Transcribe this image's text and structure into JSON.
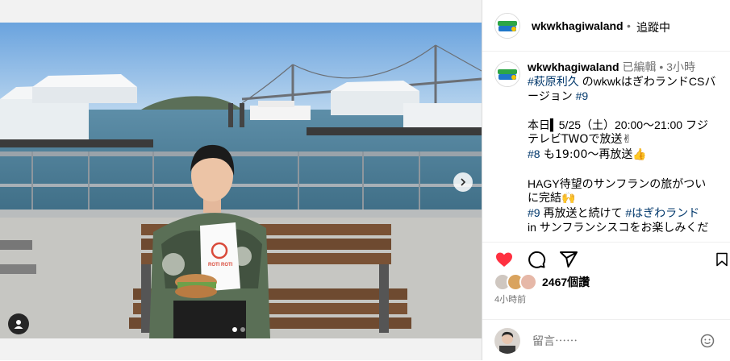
{
  "post": {
    "username": "wkwkhagiwaland",
    "header_separator": "•",
    "follow_status": "追蹤中",
    "caption": {
      "username": "wkwkhagiwaland",
      "edited": "已編輯",
      "separator": "•",
      "time": "3小時",
      "lines": [
        {
          "tag": "#萩原利久",
          "text": " のwkwkはぎわランドCSバ"
        },
        {
          "text": "ージョン "
        },
        {
          "text": ""
        },
        {
          "text": "本日▍5/25（土）20:00～21:00 フジ"
        },
        {
          "text": "テレビTWOで放送✌"
        },
        {
          "tag": "#8",
          "text": " も19:00～再放送👍"
        },
        {
          "text": ""
        },
        {
          "text": "HAGY待望のサンフランの旅がつい"
        },
        {
          "text": "に完結🙌"
        },
        {
          "tag": "#9",
          "text": " 再放送と続けて "
        },
        {
          "text": "in サンフランシスコをお楽しみくだ"
        }
      ],
      "line2_tag": "#9",
      "line10_tag2": "#はぎわランド"
    },
    "likes_count": "2467個讚",
    "time_ago": "4小時前",
    "comment_placeholder": "留言⋯⋯",
    "photo_sign_text": "ROTI ROTI"
  },
  "icons": {
    "like": "heart-filled-icon",
    "comment": "comment-icon",
    "share": "share-icon",
    "save": "bookmark-icon",
    "next": "chevron-right-icon",
    "tag": "user-tag-icon",
    "emoji": "emoji-icon"
  },
  "colors": {
    "like": "#ff3040",
    "hashtag": "#00376b",
    "meta": "#737373",
    "border": "#dbdbdb"
  },
  "carousel": {
    "current": 1,
    "total": 2
  }
}
